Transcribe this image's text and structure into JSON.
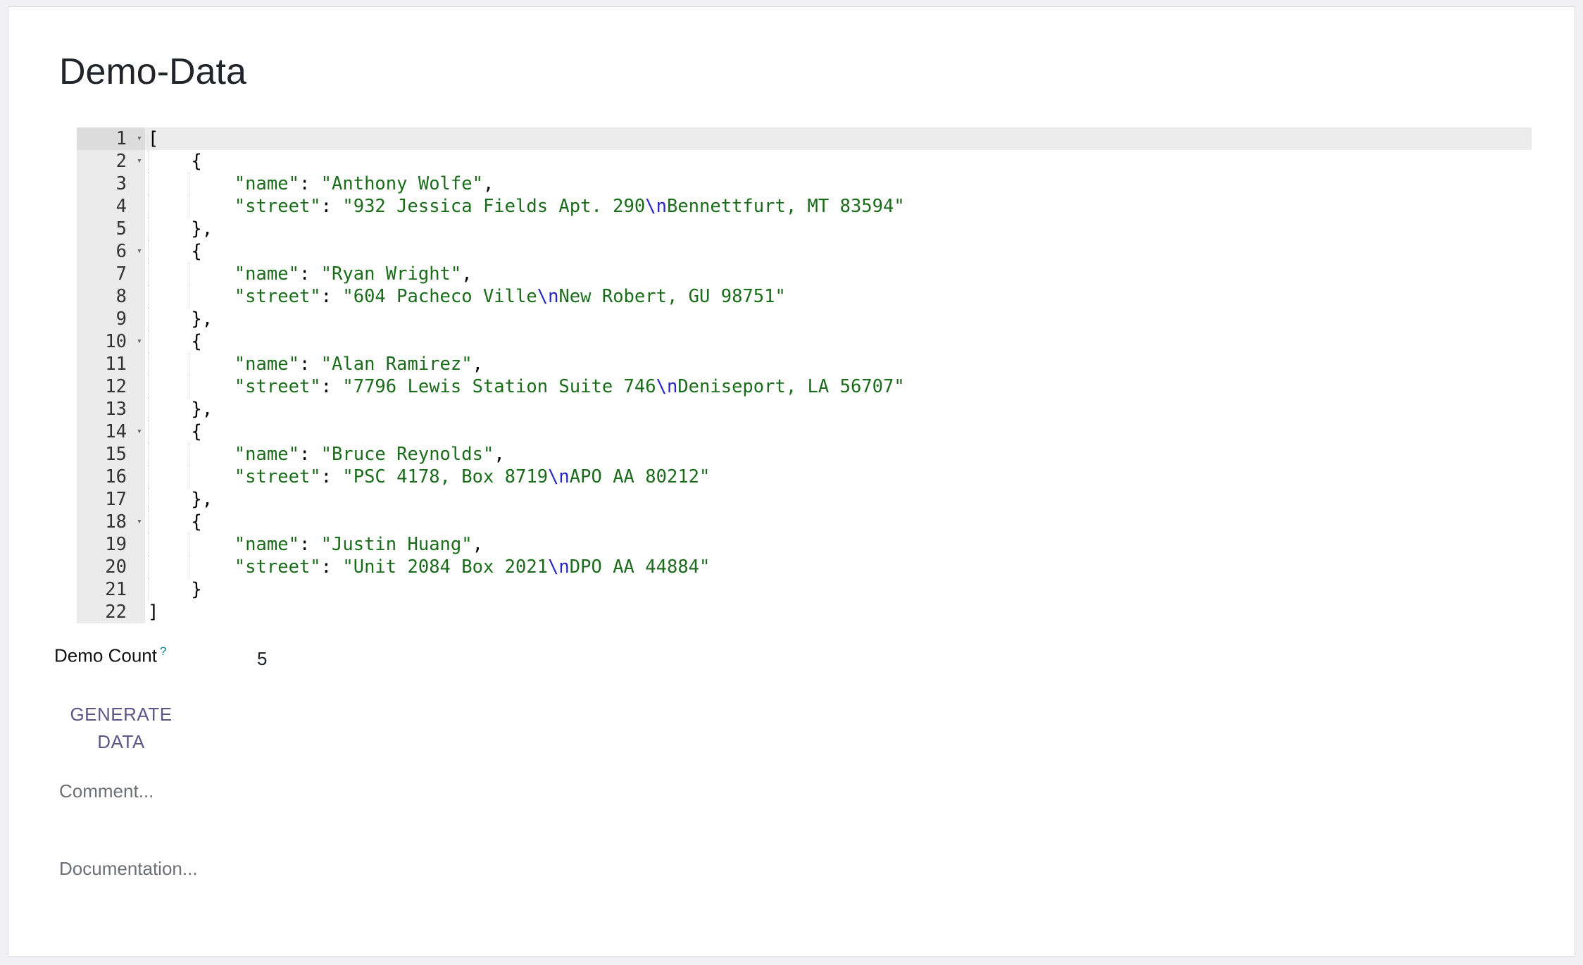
{
  "page": {
    "title": "Demo-Data"
  },
  "editor": {
    "lines": [
      {
        "num": "1",
        "fold": true,
        "indent": 0,
        "text": "["
      },
      {
        "num": "2",
        "fold": true,
        "indent": 1,
        "text": "{"
      },
      {
        "num": "3",
        "fold": false,
        "indent": 2,
        "key": "\"name\"",
        "sep": ": ",
        "parts": [
          "\"Anthony Wolfe\""
        ],
        "trail": ","
      },
      {
        "num": "4",
        "fold": false,
        "indent": 2,
        "key": "\"street\"",
        "sep": ": ",
        "parts": [
          "\"932 Jessica Fields Apt. 290",
          "\\n",
          "Bennettfurt, MT 83594\""
        ],
        "trail": ""
      },
      {
        "num": "5",
        "fold": false,
        "indent": 1,
        "text": "},"
      },
      {
        "num": "6",
        "fold": true,
        "indent": 1,
        "text": "{"
      },
      {
        "num": "7",
        "fold": false,
        "indent": 2,
        "key": "\"name\"",
        "sep": ": ",
        "parts": [
          "\"Ryan Wright\""
        ],
        "trail": ","
      },
      {
        "num": "8",
        "fold": false,
        "indent": 2,
        "key": "\"street\"",
        "sep": ": ",
        "parts": [
          "\"604 Pacheco Ville",
          "\\n",
          "New Robert, GU 98751\""
        ],
        "trail": ""
      },
      {
        "num": "9",
        "fold": false,
        "indent": 1,
        "text": "},"
      },
      {
        "num": "10",
        "fold": true,
        "indent": 1,
        "text": "{"
      },
      {
        "num": "11",
        "fold": false,
        "indent": 2,
        "key": "\"name\"",
        "sep": ": ",
        "parts": [
          "\"Alan Ramirez\""
        ],
        "trail": ","
      },
      {
        "num": "12",
        "fold": false,
        "indent": 2,
        "key": "\"street\"",
        "sep": ": ",
        "parts": [
          "\"7796 Lewis Station Suite 746",
          "\\n",
          "Deniseport, LA 56707\""
        ],
        "trail": ""
      },
      {
        "num": "13",
        "fold": false,
        "indent": 1,
        "text": "},"
      },
      {
        "num": "14",
        "fold": true,
        "indent": 1,
        "text": "{"
      },
      {
        "num": "15",
        "fold": false,
        "indent": 2,
        "key": "\"name\"",
        "sep": ": ",
        "parts": [
          "\"Bruce Reynolds\""
        ],
        "trail": ","
      },
      {
        "num": "16",
        "fold": false,
        "indent": 2,
        "key": "\"street\"",
        "sep": ": ",
        "parts": [
          "\"PSC 4178, Box 8719",
          "\\n",
          "APO AA 80212\""
        ],
        "trail": ""
      },
      {
        "num": "17",
        "fold": false,
        "indent": 1,
        "text": "},"
      },
      {
        "num": "18",
        "fold": true,
        "indent": 1,
        "text": "{"
      },
      {
        "num": "19",
        "fold": false,
        "indent": 2,
        "key": "\"name\"",
        "sep": ": ",
        "parts": [
          "\"Justin Huang\""
        ],
        "trail": ","
      },
      {
        "num": "20",
        "fold": false,
        "indent": 2,
        "key": "\"street\"",
        "sep": ": ",
        "parts": [
          "\"Unit 2084 Box 2021",
          "\\n",
          "DPO AA 44884\""
        ],
        "trail": ""
      },
      {
        "num": "21",
        "fold": false,
        "indent": 1,
        "text": "}"
      },
      {
        "num": "22",
        "fold": false,
        "indent": 0,
        "text": "]"
      }
    ],
    "active_line": "1"
  },
  "demo_count": {
    "label": "Demo Count",
    "help": "?",
    "value": "5"
  },
  "generate_button": {
    "label": "GENERATE DATA"
  },
  "comment": {
    "placeholder": "Comment..."
  },
  "documentation": {
    "placeholder": "Documentation..."
  },
  "colors": {
    "string": "#1a6b1a",
    "escape": "#2424c8",
    "button": "#5f5586",
    "help": "#017e84"
  }
}
